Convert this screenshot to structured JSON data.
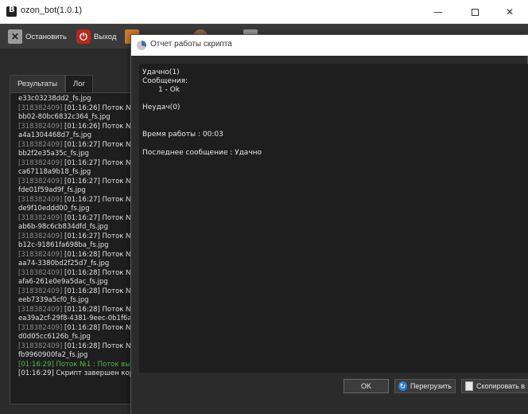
{
  "window": {
    "title": "ozon_bot(1.0.1)",
    "minimize": "—",
    "close": "✕"
  },
  "toolbar": {
    "stop_label": "Остановить",
    "exit_label": "Выход",
    "stop_icon": "x-icon",
    "exit_icon": "power-icon"
  },
  "tabs": [
    {
      "label": "Результаты"
    },
    {
      "label": "Лог"
    }
  ],
  "log": {
    "lines": [
      {
        "id": "",
        "text": "e33c03238dd2_fs.jpg"
      },
      {
        "id": "[318382409]",
        "text": " [01:16:26] Поток №"
      },
      {
        "id": "",
        "text": "bb02-80bc6832c364_fs.jpg"
      },
      {
        "id": "[318382409]",
        "text": " [01:16:26] Поток №"
      },
      {
        "id": "",
        "text": "a4a1304468d7_fs.jpg"
      },
      {
        "id": "[318382409]",
        "text": " [01:16:27] Поток №"
      },
      {
        "id": "",
        "text": "bb2f2e35a35c_fs.jpg"
      },
      {
        "id": "[318382409]",
        "text": " [01:16:27] Поток №"
      },
      {
        "id": "",
        "text": "ca67118a9b18_fs.jpg"
      },
      {
        "id": "[318382409]",
        "text": " [01:16:27] Поток №"
      },
      {
        "id": "",
        "text": "fde01f59ad9f_fs.jpg"
      },
      {
        "id": "[318382409]",
        "text": " [01:16:27] Поток №"
      },
      {
        "id": "",
        "text": "de9f10eddd00_fs.jpg"
      },
      {
        "id": "[318382409]",
        "text": " [01:16:27] Поток №"
      },
      {
        "id": "",
        "text": "ab6b-98c6cb834dfd_fs.jpg"
      },
      {
        "id": "[318382409]",
        "text": " [01:16:27] Поток №"
      },
      {
        "id": "",
        "text": "b12c-91861fa698ba_fs.jpg"
      },
      {
        "id": "[318382409]",
        "text": " [01:16:28] Поток №"
      },
      {
        "id": "",
        "text": "aa74-3380bd2f25d7_fs.jpg"
      },
      {
        "id": "[318382409]",
        "text": " [01:16:28] Поток №"
      },
      {
        "id": "",
        "text": "afa6-261e0e9a5dac_fs.jpg"
      },
      {
        "id": "[318382409]",
        "text": " [01:16:28] Поток №"
      },
      {
        "id": "",
        "text": "eeb7339a5cf0_fs.jpg"
      },
      {
        "id": "[318382409]",
        "text": " [01:16:28] Поток №"
      },
      {
        "id": "",
        "text": "ea39a2cf-29f8-4381-9eec-0b1f6a"
      },
      {
        "id": "[318382409]",
        "text": " [01:16:28] Поток №"
      },
      {
        "id": "",
        "text": "d0d05cc6126b_fs.jpg"
      },
      {
        "id": "[318382409]",
        "text": " [01:16:28] Поток №"
      },
      {
        "id": "",
        "text": "fb9960900fa2_fs.jpg"
      }
    ],
    "final_green": "[01:16:29] Поток №1 : Поток вы",
    "final_line": "[01:16:29] Скрипт завершен кор"
  },
  "dialog": {
    "title": "Отчет работы скрипта",
    "success": "Удачно(1)",
    "messages_label": "Сообщения:",
    "message_item": "1 - Ok",
    "failures": "Неудач(0)",
    "runtime": "Время работы : 00:03",
    "last_message": "Последнее сообщение : Удачно",
    "ok_label": "OK",
    "reload_label": "Перегрузить",
    "copy_label": "Скопировать в"
  }
}
